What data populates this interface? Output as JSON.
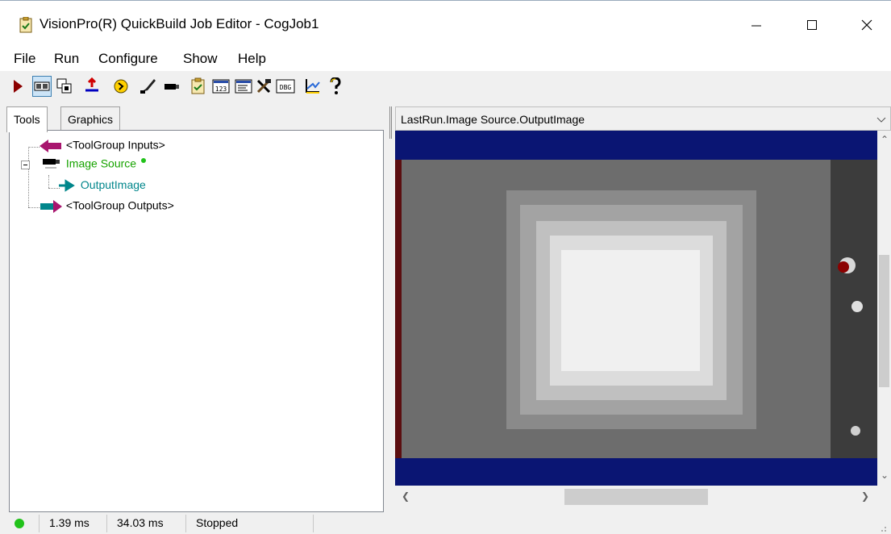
{
  "window": {
    "title": "VisionPro(R) QuickBuild Job Editor - CogJob1"
  },
  "menu": [
    "File",
    "Run",
    "Configure",
    "Show",
    "Help"
  ],
  "toolbar": {
    "icons": [
      "run-icon",
      "display-icon",
      "float-window-icon",
      "import-icon",
      "reset-icon",
      "edit-icon",
      "camera-icon",
      "job-properties-icon",
      "counter-icon",
      "results-icon",
      "tools-icon",
      "debug-icon",
      "settings-icon",
      "help-icon"
    ],
    "counter_label": "123",
    "debug_label": "DBG"
  },
  "tabs": [
    "Tools",
    "Graphics"
  ],
  "tree": {
    "inputs": "<ToolGroup Inputs>",
    "image_source": "Image Source",
    "output_image": "OutputImage",
    "outputs": "<ToolGroup Outputs>"
  },
  "display": {
    "header": "LastRun.Image Source.OutputImage"
  },
  "status": {
    "time1": "1.39 ms",
    "time2": "34.03 ms",
    "state": "Stopped"
  },
  "colors": {
    "status_ok": "#21c21a",
    "border_band": "#0a1573",
    "tree_green": "#17a300",
    "tree_teal": "#00868b"
  }
}
